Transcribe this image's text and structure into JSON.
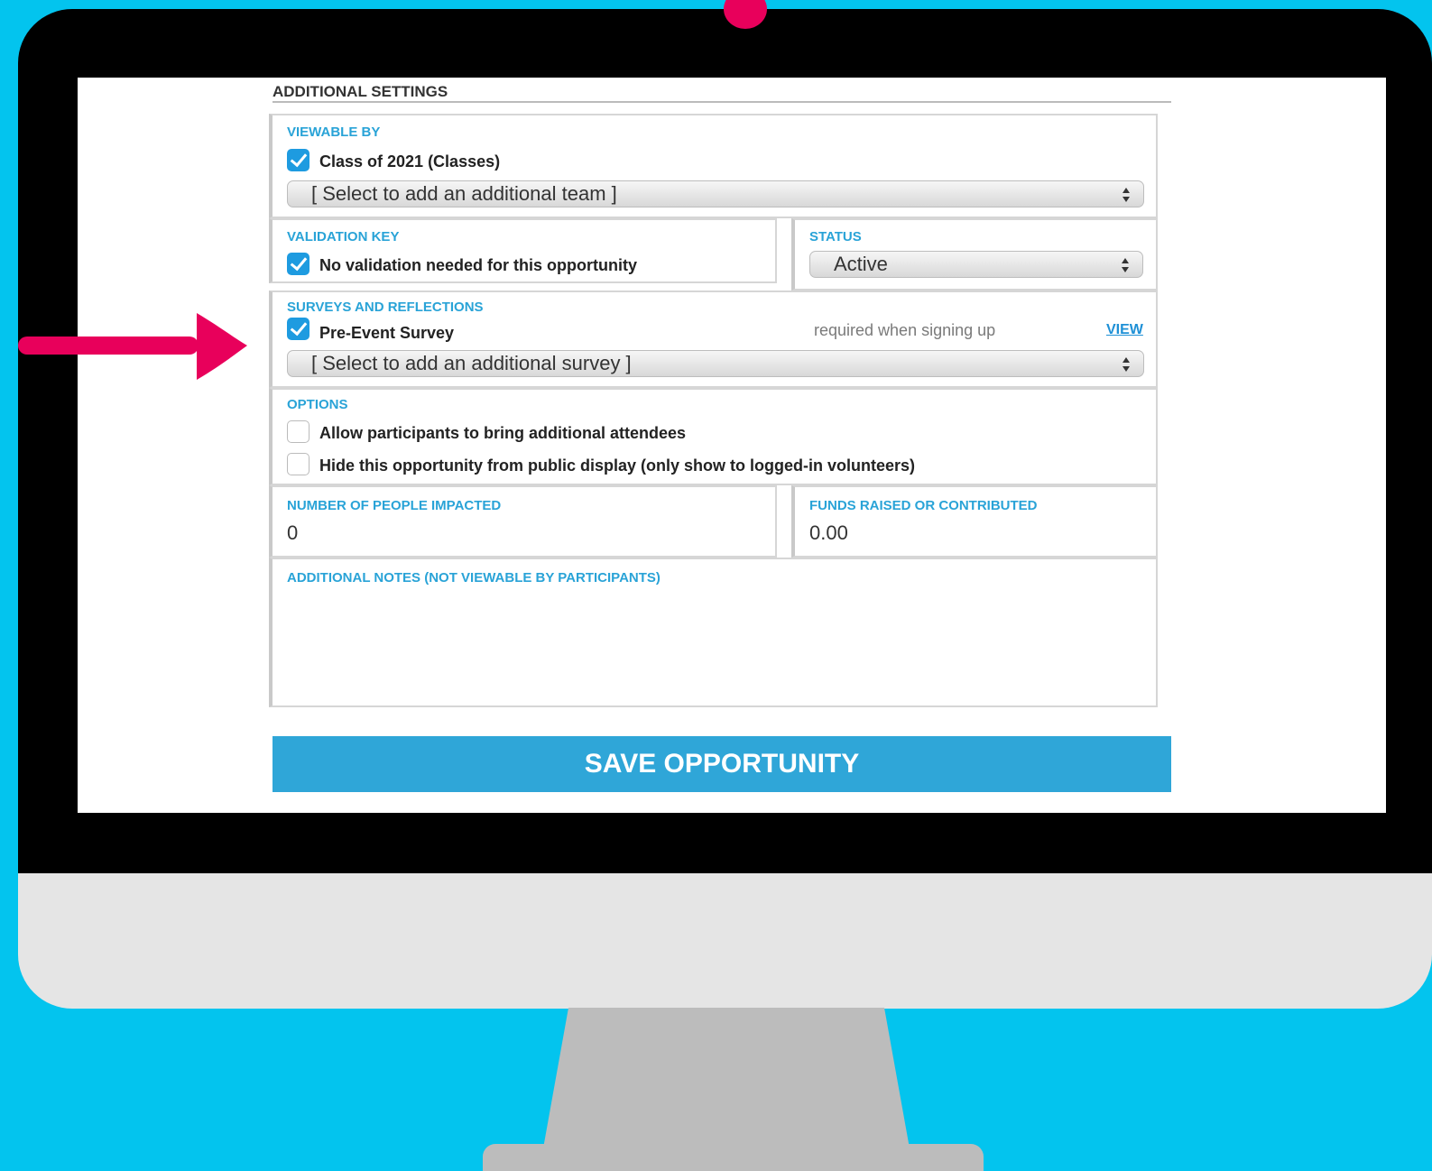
{
  "section_title": "ADDITIONAL SETTINGS",
  "viewable_by": {
    "label": "VIEWABLE BY",
    "checked_item": "Class of 2021 (Classes)",
    "team_select": "[ Select to add an additional team ]"
  },
  "validation_key": {
    "label": "VALIDATION KEY",
    "checked_item": "No validation needed for this opportunity"
  },
  "status": {
    "label": "STATUS",
    "value": "Active"
  },
  "surveys": {
    "label": "SURVEYS AND REFLECTIONS",
    "checked_item": "Pre-Event Survey",
    "note": "required when signing up",
    "view_link": "VIEW",
    "survey_select": "[ Select to add an additional survey ]"
  },
  "options": {
    "label": "OPTIONS",
    "items": [
      {
        "label": "Allow participants to bring additional attendees",
        "checked": false
      },
      {
        "label": "Hide this opportunity from public display (only show to logged-in volunteers)",
        "checked": false
      }
    ]
  },
  "people_impacted": {
    "label": "NUMBER OF PEOPLE IMPACTED",
    "value": "0"
  },
  "funds_raised": {
    "label": "FUNDS RAISED OR CONTRIBUTED",
    "value": "0.00"
  },
  "notes": {
    "label": "ADDITIONAL NOTES (NOT VIEWABLE BY PARTICIPANTS)"
  },
  "save_button": "SAVE OPPORTUNITY",
  "colors": {
    "background": "#03c4ee",
    "accent_blue": "#2fa6d8",
    "arrow_pink": "#e8005b",
    "check_blue": "#1e9be0"
  }
}
